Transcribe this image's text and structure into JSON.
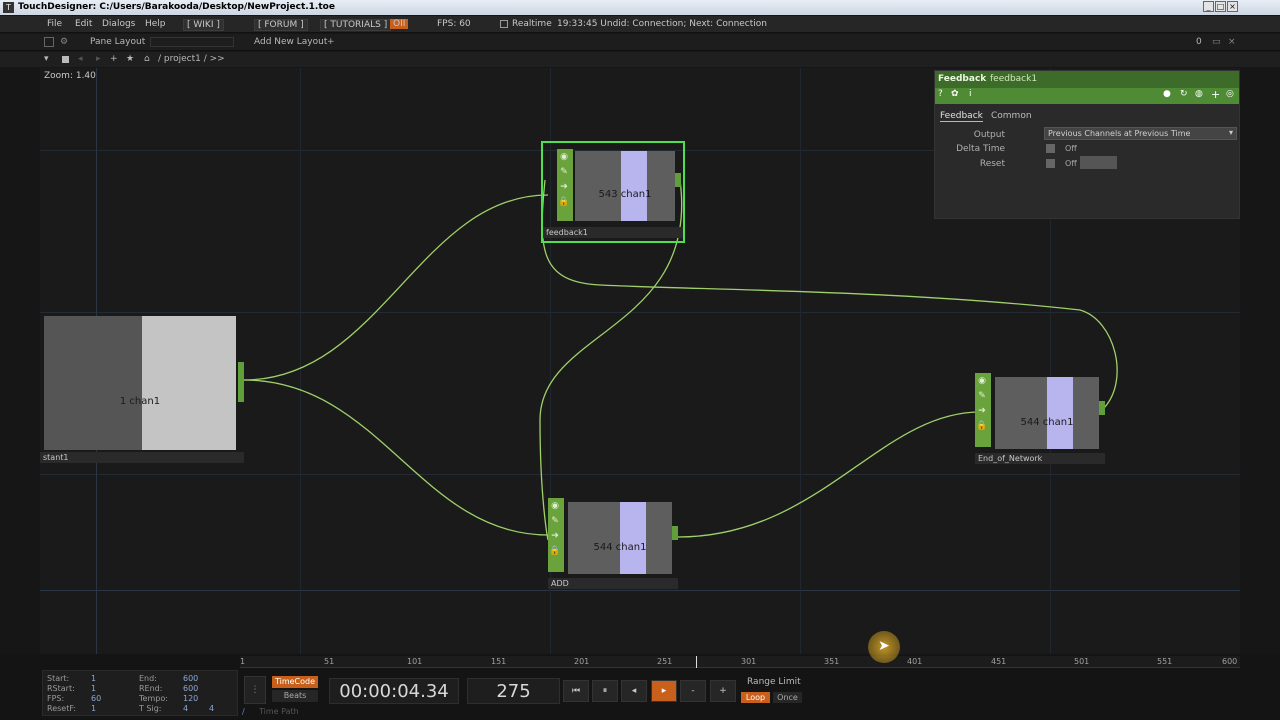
{
  "window": {
    "title": "TouchDesigner: C:/Users/Barakooda/Desktop/NewProject.1.toe",
    "app_icon": "touchdesigner-icon",
    "controls": [
      "_",
      "□",
      "×"
    ]
  },
  "menubar": {
    "file": "File",
    "edit": "Edit",
    "dialogs": "Dialogs",
    "help": "Help",
    "wiki": "[ WIKI ]",
    "forum": "[ FORUM ]",
    "tutorials": "[ TUTORIALS ]",
    "oi": "OII",
    "fps": "FPS: 60",
    "realtime": "Realtime",
    "status": "19:33:45 Undid: Connection; Next: Connection"
  },
  "panebar": {
    "pane_layout": "Pane Layout",
    "add_new_layout": "Add New Layout",
    "right_value": "0"
  },
  "pathbar": {
    "path": "/ project1 / >>"
  },
  "network": {
    "zoom": "Zoom: 1.40",
    "nodes": {
      "feedback1": {
        "name": "feedback1",
        "text": "543 chan1"
      },
      "constant1": {
        "name": "stant1",
        "text": "1 chan1"
      },
      "add": {
        "name": "ADD",
        "text": "544 chan1"
      },
      "end": {
        "name": "End_of_Network",
        "text": "544 chan1"
      }
    }
  },
  "params": {
    "op_type": "Feedback",
    "op_name": "feedback1",
    "tabs": [
      "Feedback",
      "Common"
    ],
    "output_label": "Output",
    "output_value": "Previous Channels at Previous Time",
    "delta_time_label": "Delta Time",
    "delta_time_value": "Off",
    "reset_label": "Reset",
    "reset_value": "Off"
  },
  "timeline": {
    "ruler": [
      "1",
      "51",
      "101",
      "151",
      "201",
      "251",
      "301",
      "351",
      "401",
      "451",
      "501",
      "551",
      "600"
    ],
    "start_label": "Start:",
    "start": "1",
    "end_label": "End:",
    "end": "600",
    "rstart_label": "RStart:",
    "rstart": "1",
    "rend_label": "REnd:",
    "rend": "600",
    "fps_label": "FPS:",
    "fps": "60",
    "tempo_label": "Tempo:",
    "tempo": "120",
    "resetf_label": "ResetF:",
    "resetf": "1",
    "tsig_label": "T Sig:",
    "tsig1": "4",
    "tsig2": "4",
    "timecode_btn": "TimeCode",
    "beats_btn": "Beats",
    "timecode": "00:00:04.34",
    "frame": "275",
    "range_limit": "Range Limit",
    "loop": "Loop",
    "once": "Once",
    "time_path": "Time Path"
  },
  "colors": {
    "wire": "#9fd06a",
    "chop_green": "#6aa23c",
    "selected": "#4fe04f",
    "accent_orange": "#c8601c"
  }
}
